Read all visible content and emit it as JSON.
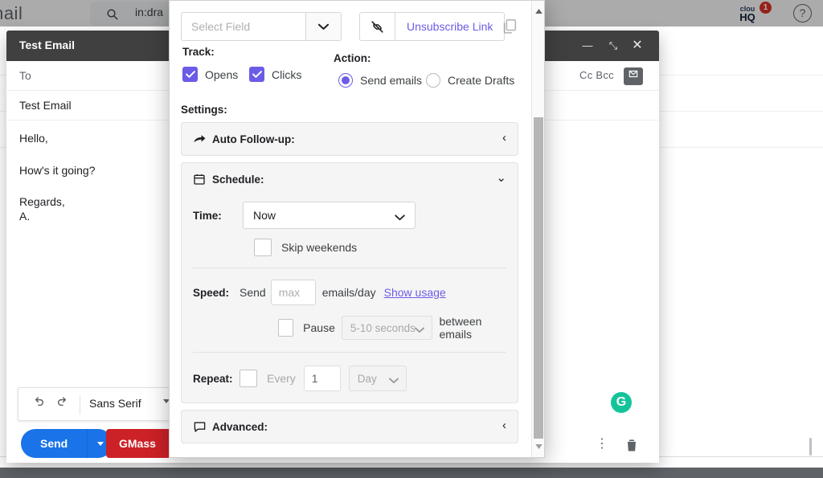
{
  "gmail": {
    "logo_text": "mail",
    "search": {
      "icon": "search-icon",
      "value": "in:dra"
    },
    "cloudhq": {
      "line1": "clou",
      "line2": "HQ",
      "badge_count": "1"
    },
    "help_icon_glyph": "?"
  },
  "compose": {
    "title": "Test Email",
    "controls": {
      "minimize": "—",
      "popout": "⤡",
      "close": "✕"
    },
    "to_placeholder": "To",
    "cc_bcc": "Cc Bcc",
    "subject_value": "Test Email",
    "body_lines": [
      "Hello,",
      "How's it going?",
      "Regards,",
      "A."
    ],
    "format_toolbar": {
      "undo_icon": "undo-icon",
      "redo_icon": "redo-icon",
      "font_name": "Sans Serif"
    },
    "footer": {
      "send_label": "Send",
      "gmass_label": "GMass",
      "more_options_icon": "more-vertical-icon",
      "trash_icon": "trash-icon",
      "grammarly_glyph": "G"
    }
  },
  "gmass_panel": {
    "select_field": {
      "placeholder": "Select Field",
      "caret_icon": "chevron-down-icon"
    },
    "unsubscribe": {
      "icon": "broken-link-icon",
      "label": "Unsubscribe Link"
    },
    "copy_icon": "copy-icon",
    "track": {
      "heading": "Track:",
      "items": [
        {
          "label": "Opens",
          "checked": true
        },
        {
          "label": "Clicks",
          "checked": true
        }
      ]
    },
    "action": {
      "heading": "Action:",
      "options": [
        {
          "label": "Send emails",
          "selected": true
        },
        {
          "label": "Create Drafts",
          "selected": false
        }
      ]
    },
    "settings_heading": "Settings:",
    "sections": {
      "auto_followup": {
        "icon": "forward-arrow-icon",
        "title": "Auto Follow-up:",
        "chevron": "‹",
        "expanded": false
      },
      "schedule": {
        "icon": "calendar-icon",
        "title": "Schedule:",
        "chevron": "⌄",
        "expanded": true
      },
      "advanced": {
        "icon": "comment-icon",
        "title": "Advanced:",
        "chevron": "‹",
        "expanded": false
      }
    },
    "schedule": {
      "time_label": "Time:",
      "time_value": "Now",
      "skip_weekends": {
        "label": "Skip weekends",
        "checked": false
      },
      "speed": {
        "label": "Speed:",
        "send_word": "Send",
        "amount_placeholder": "max",
        "unit": "emails/day",
        "show_usage_link": "Show usage"
      },
      "pause": {
        "checked": false,
        "word": "Pause",
        "interval_value": "5-10 seconds",
        "tail": "between emails"
      },
      "repeat": {
        "label": "Repeat:",
        "checked": false,
        "every_word": "Every",
        "count": "1",
        "unit": "Day"
      }
    },
    "scrollbar": {
      "up_arrow": "▲",
      "down_arrow": "▼"
    }
  },
  "colors": {
    "accent_purple": "#6b5ce7",
    "send_blue": "#1a73e8",
    "gmass_red": "#cc2127",
    "grammarly_green": "#15c39a",
    "badge_red": "#d93025"
  }
}
